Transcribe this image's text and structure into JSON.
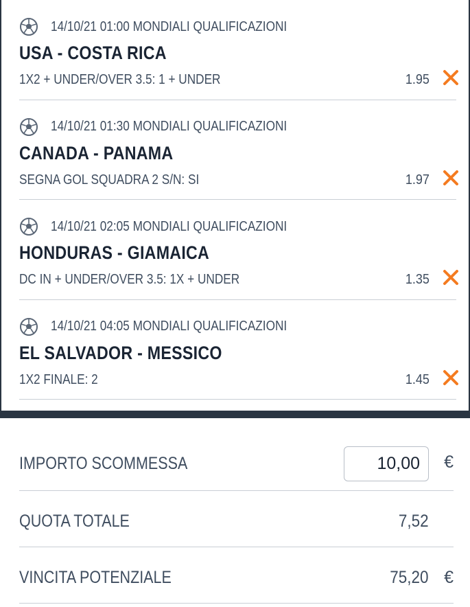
{
  "bets": [
    {
      "date_time": "14/10/21 01:00",
      "competition": "MONDIALI QUALIFICAZIONI",
      "match": "USA - COSTA RICA",
      "market": "1X2 + UNDER/OVER 3.5: 1 + UNDER",
      "odd": "1.95",
      "icon": "soccer-ball-icon"
    },
    {
      "date_time": "14/10/21 01:30",
      "competition": "MONDIALI QUALIFICAZIONI",
      "match": "CANADA - PANAMA",
      "market": "SEGNA GOL SQUADRA 2 S/N: SI",
      "odd": "1.97",
      "icon": "soccer-ball-icon"
    },
    {
      "date_time": "14/10/21 02:05",
      "competition": "MONDIALI QUALIFICAZIONI",
      "match": "HONDURAS - GIAMAICA",
      "market": "DC IN + UNDER/OVER 3.5: 1X + UNDER",
      "odd": "1.35",
      "icon": "soccer-ball-icon"
    },
    {
      "date_time": "14/10/21 04:05",
      "competition": "MONDIALI QUALIFICAZIONI",
      "match": "EL SALVADOR - MESSICO",
      "market": "1X2 FINALE: 2",
      "odd": "1.45",
      "icon": "soccer-ball-icon"
    }
  ],
  "summary": {
    "stake_label": "IMPORTO SCOMMESSA",
    "stake_value": "10,00",
    "stake_currency": "€",
    "total_odds_label": "QUOTA TOTALE",
    "total_odds_value": "7,52",
    "potential_win_label": "VINCITA POTENZIALE",
    "potential_win_value": "75,20",
    "potential_win_currency": "€"
  },
  "colors": {
    "accent_remove": "#f47b20",
    "dark_band": "#2a3542",
    "text_primary": "#1a2433",
    "text_secondary": "#3f4d5f"
  }
}
